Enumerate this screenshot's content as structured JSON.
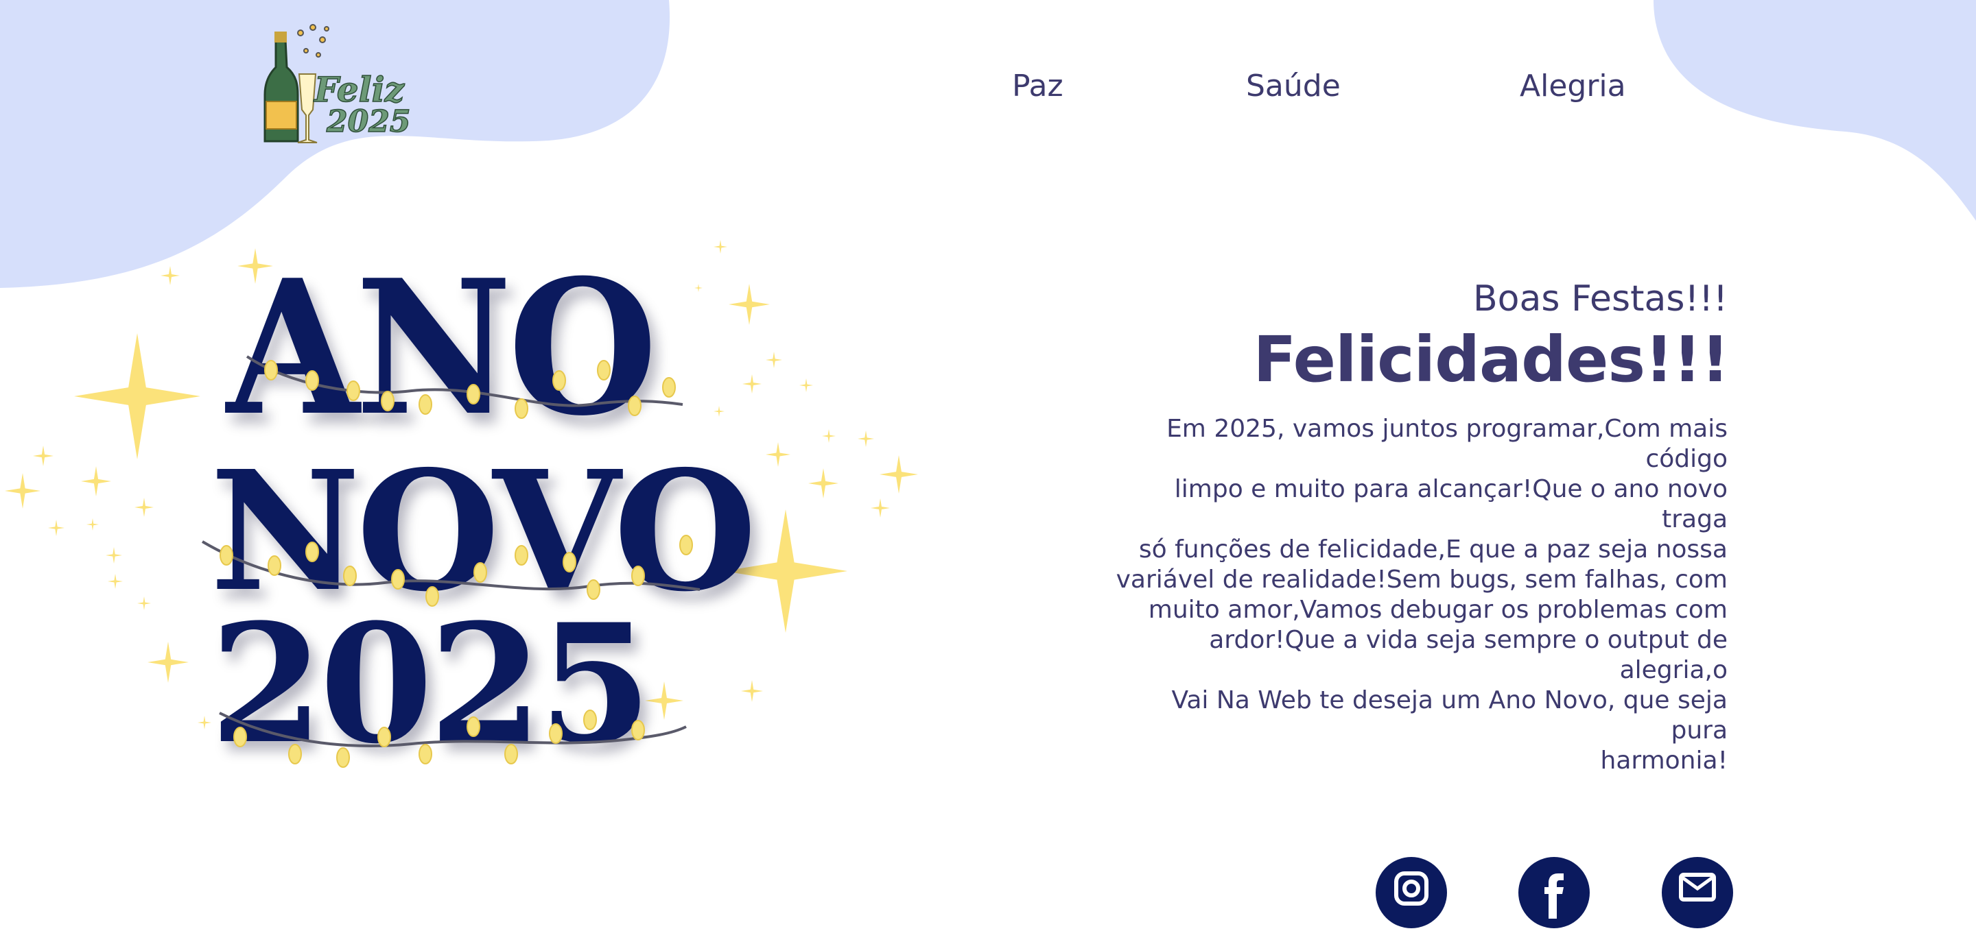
{
  "brand": {
    "logo_line1": "Feliz",
    "logo_line2": "2025"
  },
  "nav": {
    "items": [
      {
        "label": "Paz"
      },
      {
        "label": "Saúde"
      },
      {
        "label": "Alegria"
      }
    ]
  },
  "hero": {
    "art_line1": "ANO",
    "art_line2": "NOVO",
    "art_line3": "2025"
  },
  "content": {
    "greeting": "Boas Festas!!!",
    "headline": "Felicidades!!!",
    "message_lines": [
      "Em 2025, vamos juntos programar,Com mais código",
      "limpo e muito para alcançar!Que o ano novo traga",
      "só funções de felicidade,E que a paz seja nossa",
      "variável de realidade!Sem bugs, sem falhas, com",
      "muito amor,Vamos debugar os problemas com",
      "ardor!Que a vida seja sempre o output de alegria,o",
      "Vai Na Web te deseja um Ano Novo, que seja pura",
      "harmonia!"
    ]
  },
  "social": {
    "icons": [
      "instagram-icon",
      "facebook-icon",
      "email-icon"
    ]
  },
  "colors": {
    "blob": "#d6dffb",
    "text": "#3d3a6e",
    "navy": "#0b1a5e",
    "sparkle": "#fbe27a",
    "bulb": "#f7e27c"
  }
}
